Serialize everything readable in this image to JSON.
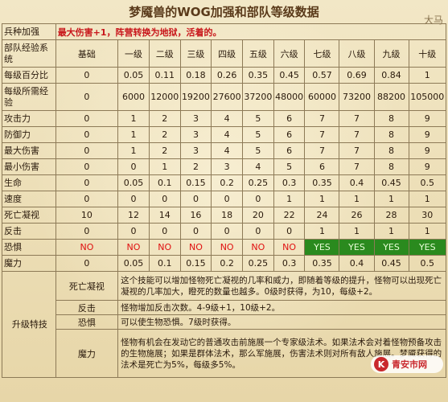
{
  "title": "梦魇兽的WOG加强和部队等级数据",
  "watermark_top": "大马",
  "logo": {
    "emblem": "K",
    "text": "青安市网"
  },
  "bonus": {
    "label": "兵种加强",
    "text": "最大伤害+1，阵营转换为地狱，活着的。"
  },
  "header": {
    "label": "部队经验系统",
    "columns": [
      "基础",
      "一级",
      "二级",
      "三级",
      "四级",
      "五级",
      "六级",
      "七级",
      "八级",
      "九级",
      "十级"
    ]
  },
  "rows": [
    {
      "label": "每级百分比",
      "values": [
        "0",
        "0.05",
        "0.11",
        "0.18",
        "0.26",
        "0.35",
        "0.45",
        "0.57",
        "0.69",
        "0.84",
        "1"
      ]
    },
    {
      "label": "每级所需经验",
      "values": [
        "0",
        "6000",
        "12000",
        "19200",
        "27600",
        "37200",
        "48000",
        "60000",
        "73200",
        "88200",
        "105000"
      ]
    },
    {
      "label": "攻击力",
      "values": [
        "0",
        "1",
        "2",
        "3",
        "4",
        "5",
        "6",
        "7",
        "7",
        "8",
        "9"
      ]
    },
    {
      "label": "防御力",
      "values": [
        "0",
        "1",
        "2",
        "3",
        "4",
        "5",
        "6",
        "7",
        "7",
        "8",
        "9"
      ]
    },
    {
      "label": "最大伤害",
      "values": [
        "0",
        "1",
        "2",
        "3",
        "4",
        "5",
        "6",
        "7",
        "7",
        "8",
        "9"
      ]
    },
    {
      "label": "最小伤害",
      "values": [
        "0",
        "0",
        "1",
        "2",
        "3",
        "4",
        "5",
        "6",
        "7",
        "8",
        "9"
      ]
    },
    {
      "label": "生命",
      "values": [
        "0",
        "0.05",
        "0.1",
        "0.15",
        "0.2",
        "0.25",
        "0.3",
        "0.35",
        "0.4",
        "0.45",
        "0.5"
      ]
    },
    {
      "label": "速度",
      "values": [
        "0",
        "0",
        "0",
        "0",
        "0",
        "0",
        "1",
        "1",
        "1",
        "1",
        "1"
      ]
    },
    {
      "label": "死亡凝视",
      "values": [
        "10",
        "12",
        "14",
        "16",
        "18",
        "20",
        "22",
        "24",
        "26",
        "28",
        "30"
      ]
    },
    {
      "label": "反击",
      "values": [
        "0",
        "0",
        "0",
        "0",
        "0",
        "0",
        "0",
        "1",
        "1",
        "1",
        "1"
      ]
    },
    {
      "label": "恐惧",
      "values": [
        "NO",
        "NO",
        "NO",
        "NO",
        "NO",
        "NO",
        "NO",
        "YES",
        "YES",
        "YES",
        "YES"
      ]
    },
    {
      "label": "魔力",
      "values": [
        "0",
        "0.05",
        "0.1",
        "0.15",
        "0.2",
        "0.25",
        "0.3",
        "0.35",
        "0.4",
        "0.45",
        "0.5"
      ]
    }
  ],
  "skills": {
    "label": "升级特技",
    "items": [
      {
        "name": "死亡凝视",
        "text": "这个技能可以增加怪物死亡凝视的几率和威力，即随着等级的提升，怪物可以出现死亡凝视的几率加大，瞪死的数量也越多。0级时获得，为10，每级+2。"
      },
      {
        "name": "反击",
        "text": "怪物增加反击次数。4-9级+1，10级+2。"
      },
      {
        "name": "恐惧",
        "text": "可以使生物恐惧。7级时获得。"
      },
      {
        "name": "魔力",
        "text": "怪物有机会在发动它的普通攻击前施展一个专家级法术。如果法术会对着怪物预备攻击的生物施展；如果是群体法术，那么军施展，伤害法术则对所有敌人施展。梦魇获得的法术是死亡为5%，每级多5%。"
      }
    ]
  }
}
